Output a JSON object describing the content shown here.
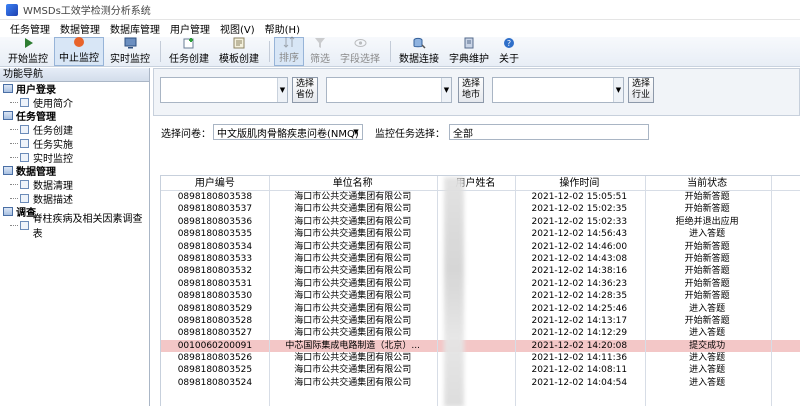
{
  "app": {
    "title": "WMSDs工效学检测分析系统"
  },
  "menu": [
    "任务管理",
    "数据管理",
    "数据库管理",
    "用户管理",
    "视图(V)",
    "帮助(H)"
  ],
  "toolbar": {
    "start_monitor": "开始监控",
    "stop_monitor": "中止监控",
    "realtime_monitor": "实时监控",
    "task_create": "任务创建",
    "template_create": "模板创建",
    "sort": "排序",
    "filter": "筛选",
    "field_select": "字段选择",
    "db_connect": "数据连接",
    "dict_maintain": "字典维护",
    "about": "关于"
  },
  "nav": {
    "header": "功能导航",
    "groups": [
      {
        "label": "用户登录",
        "items": [
          "使用简介"
        ]
      },
      {
        "label": "任务管理",
        "items": [
          "任务创建",
          "任务实施",
          "实时监控"
        ]
      },
      {
        "label": "数据管理",
        "items": [
          "数据清理",
          "数据描述"
        ]
      },
      {
        "label": "调查",
        "items": [
          "脊柱疾病及相关因素调查表"
        ]
      }
    ]
  },
  "filters": {
    "province_btn": "选择\n省份",
    "city_btn": "选择\n地市",
    "industry_btn": "选择\n行业"
  },
  "selectors": {
    "questionnaire_label": "选择问卷：",
    "questionnaire_value": "中文版肌肉骨骼疾患问卷(NMQ)",
    "task_label": "监控任务选择：",
    "task_value": "全部"
  },
  "table": {
    "headers": [
      "用户编号",
      "单位名称",
      "用户姓名",
      "操作时间",
      "当前状态"
    ],
    "rows": [
      [
        "0898180803538",
        "海口市公共交通集团有限公司",
        "",
        "2021-12-02 15:05:51",
        "开始新答题"
      ],
      [
        "0898180803537",
        "海口市公共交通集团有限公司",
        "",
        "2021-12-02 15:02:35",
        "开始新答题"
      ],
      [
        "0898180803536",
        "海口市公共交通集团有限公司",
        "",
        "2021-12-02 15:02:33",
        "拒绝并退出应用"
      ],
      [
        "0898180803535",
        "海口市公共交通集团有限公司",
        "",
        "2021-12-02 14:56:43",
        "进入答题"
      ],
      [
        "0898180803534",
        "海口市公共交通集团有限公司",
        "",
        "2021-12-02 14:46:00",
        "开始新答题"
      ],
      [
        "0898180803533",
        "海口市公共交通集团有限公司",
        "",
        "2021-12-02 14:43:08",
        "开始新答题"
      ],
      [
        "0898180803532",
        "海口市公共交通集团有限公司",
        "",
        "2021-12-02 14:38:16",
        "开始新答题"
      ],
      [
        "0898180803531",
        "海口市公共交通集团有限公司",
        "",
        "2021-12-02 14:36:23",
        "开始新答题"
      ],
      [
        "0898180803530",
        "海口市公共交通集团有限公司",
        "",
        "2021-12-02 14:28:35",
        "开始新答题"
      ],
      [
        "0898180803529",
        "海口市公共交通集团有限公司",
        "",
        "2021-12-02 14:25:46",
        "进入答题"
      ],
      [
        "0898180803528",
        "海口市公共交通集团有限公司",
        "",
        "2021-12-02 14:13:17",
        "开始新答题"
      ],
      [
        "0898180803527",
        "海口市公共交通集团有限公司",
        "",
        "2021-12-02 14:12:29",
        "进入答题"
      ],
      [
        "0010060200091",
        "中芯国际集成电路制造（北京）...",
        "",
        "2021-12-02 14:20:08",
        "提交成功"
      ],
      [
        "0898180803526",
        "海口市公共交通集团有限公司",
        "",
        "2021-12-02 14:11:36",
        "进入答题"
      ],
      [
        "0898180803525",
        "海口市公共交通集团有限公司",
        "",
        "2021-12-02 14:08:11",
        "进入答题"
      ],
      [
        "0898180803524",
        "海口市公共交通集团有限公司",
        "",
        "2021-12-02 14:04:54",
        "进入答题"
      ]
    ],
    "highlight_row": 12,
    "highlight_color": "#f3c7c7"
  }
}
